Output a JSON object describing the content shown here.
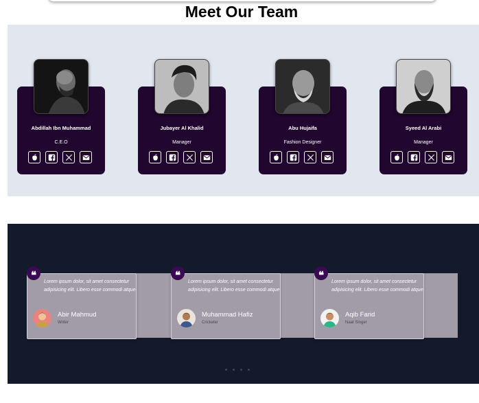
{
  "section_title": "Meet Our Team",
  "team": [
    {
      "name": "Abdillah Ibn Muhammad",
      "role": "C.E.O"
    },
    {
      "name": "Jubayer Al Khalid",
      "role": "Manager"
    },
    {
      "name": "Abu Hujaifa",
      "role": "Fashion Designer"
    },
    {
      "name": "Syeed Al Arabi",
      "role": "Manager"
    }
  ],
  "social_icons": [
    "apple-icon",
    "facebook-icon",
    "x-icon",
    "mail-icon"
  ],
  "testimonials": [
    {
      "quote": "Lorem ipsum dolor, sit amet consectetur adipisicing elit. Libero esse commodi atque",
      "name": "Abir Mahmud",
      "role": "Writer"
    },
    {
      "quote": "Lorem ipsum dolor, sit amet consectetur adipisicing elit. Libero esse commodi atque",
      "name": "Muhammad Hafiz",
      "role": "Cricketer"
    },
    {
      "quote": "Lorem ipsum dolor, sit amet consectetur adipisicing elit. Libero esse commodi atque",
      "name": "Aqib Farid",
      "role": "Naat Singer"
    }
  ],
  "quote_mark": "❝",
  "colors": {
    "team_bg": "#e2e6ef",
    "card_bg": "#21062f",
    "testimonial_section_bg": "#121a2c",
    "testimonial_card_bg": "#a29ca8",
    "quote_badge": "#3a0a52"
  },
  "carousel_dots": 4
}
